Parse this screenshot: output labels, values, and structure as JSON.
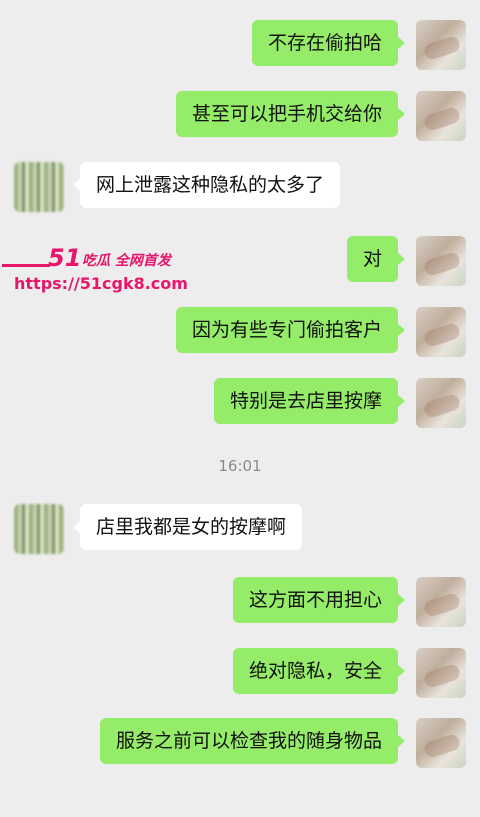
{
  "chat": {
    "messages": [
      {
        "side": "right",
        "text": "不存在偷拍哈"
      },
      {
        "side": "right",
        "text": "甚至可以把手机交给你"
      },
      {
        "side": "left",
        "text": "网上泄露这种隐私的太多了"
      },
      {
        "side": "right",
        "text": "对"
      },
      {
        "side": "right",
        "text": "因为有些专门偷拍客户"
      },
      {
        "side": "right",
        "text": "特别是去店里按摩"
      },
      {
        "side": "left",
        "text": "店里我都是女的按摩啊"
      },
      {
        "side": "right",
        "text": "这方面不用担心"
      },
      {
        "side": "right",
        "text": "绝对隐私，安全"
      },
      {
        "side": "right",
        "text": "服务之前可以检查我的随身物品"
      }
    ],
    "timestamp": "16:01"
  },
  "watermark": {
    "logo": "51",
    "tagline": "吃瓜 全网首发",
    "url": "https://51cgk8.com"
  },
  "colors": {
    "background": "#ededed",
    "own_bubble": "#95ec69",
    "other_bubble": "#ffffff",
    "watermark": "#e8156b"
  }
}
